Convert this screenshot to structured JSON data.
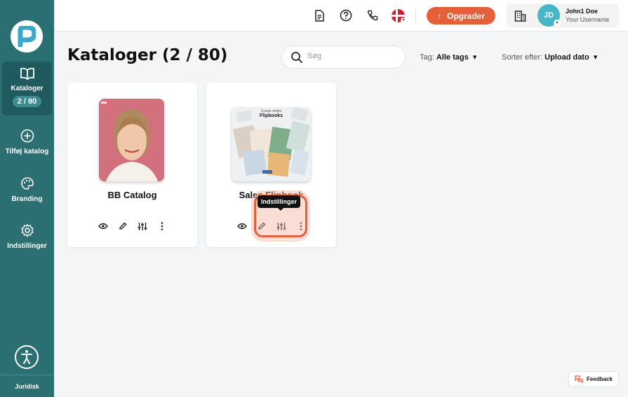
{
  "sidebar": {
    "items": [
      {
        "label": "Kataloger",
        "badge": "2 / 80",
        "icon": "book-open-icon"
      },
      {
        "label": "Tilføj katalog",
        "icon": "plus-circle-icon"
      },
      {
        "label": "Branding",
        "icon": "palette-icon"
      },
      {
        "label": "Indstillinger",
        "icon": "gear-icon"
      }
    ],
    "footer": "Juridisk"
  },
  "header": {
    "upgrade_label": "Opgrader",
    "user_initials": "JD",
    "user_name": "John1 Doe",
    "user_sub": "Your Username"
  },
  "main": {
    "title": "Kataloger (2 / 80)",
    "search_placeholder": "Søg",
    "tag_label": "Tag:",
    "tag_value": "Alle tags",
    "sort_label": "Sorter efter:",
    "sort_value": "Upload dato",
    "catalogs": [
      {
        "title": "BB Catalog"
      },
      {
        "title": "Sales Flipbook",
        "thumb_text_top": "Create online",
        "thumb_text_main": "Flipbooks"
      }
    ]
  },
  "tooltip": "Indstillinger",
  "feedback_label": "Feedback",
  "colors": {
    "sidebar": "#2b6f73",
    "accent": "#e5603a",
    "avatar": "#48b6c7"
  }
}
